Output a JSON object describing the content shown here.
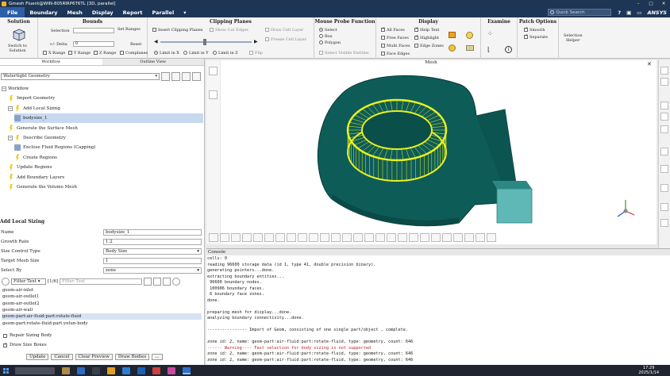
{
  "titlebar": {
    "title": "Gmesh Fluent@WIN-805RIRP6T6TL  [3D, parallel]"
  },
  "menu": {
    "items": [
      "File",
      "Boundary",
      "Mesh",
      "Display",
      "Report",
      "Parallel"
    ],
    "search_placeholder": "Quick Search",
    "brand": "ANSYS"
  },
  "ribbon": {
    "solution": {
      "title": "Solution",
      "button": "Switch to\nSolution"
    },
    "bounds": {
      "title": "Bounds",
      "selection_label": "Selection",
      "set_ranges": "Set Ranges",
      "delta_label": "+/- Delta",
      "delta_value": "0",
      "reset": "Reset",
      "x_range": "X Range",
      "y_range": "Y Range",
      "z_range": "Z Range",
      "complanes": "Complanes"
    },
    "clipping": {
      "title": "Clipping Planes",
      "insert": "Insert Clipping Planes",
      "show_cut_edges": "Show Cut Edges",
      "draw_cell_layer": "Draw Cell Layer",
      "freeze_cell_layer": "Freeze Cell Layer",
      "flip": "Flip",
      "limit_x": "Limit in X",
      "limit_y": "Limit in Y",
      "limit_z": "Limit in Z"
    },
    "probe": {
      "title": "Mouse Probe Function",
      "select": "Select",
      "box": "Box",
      "polygon": "Polygon",
      "select_visible": "Select Visible Entities"
    },
    "display": {
      "title": "Display",
      "all_faces": "All Faces",
      "free_faces": "Free Faces",
      "multi_faces": "Multi Faces",
      "face_edges": "Face Edges",
      "help_text": "Help Text",
      "highlight": "Highlight",
      "edge_zones": "Edge Zones"
    },
    "examine": {
      "title": "Examine"
    },
    "patch": {
      "title": "Patch Options",
      "smooth": "Smooth",
      "separate": "Separate"
    },
    "selection_helper": "Selection\nHelper"
  },
  "left": {
    "tabs": [
      "Workflow",
      "Outline View"
    ],
    "workflow_type": "Watertight Geometry",
    "tree": [
      {
        "label": "Workflow",
        "indent": 0,
        "kind": "root"
      },
      {
        "label": "Import Geometry",
        "indent": 1,
        "kind": "task"
      },
      {
        "label": "Add Local Sizing",
        "indent": 1,
        "kind": "task"
      },
      {
        "label": "bodysize_1",
        "indent": 2,
        "kind": "child"
      },
      {
        "label": "Generate the Surface Mesh",
        "indent": 1,
        "kind": "task"
      },
      {
        "label": "Describe Geometry",
        "indent": 1,
        "kind": "task"
      },
      {
        "label": "Enclose Fluid Regions (Capping)",
        "indent": 2,
        "kind": "child"
      },
      {
        "label": "Create Regions",
        "indent": 2,
        "kind": "task"
      },
      {
        "label": "Update Regions",
        "indent": 1,
        "kind": "task"
      },
      {
        "label": "Add Boundary Layers",
        "indent": 1,
        "kind": "task"
      },
      {
        "label": "Generate the Volume Mesh",
        "indent": 1,
        "kind": "task"
      }
    ],
    "sizing": {
      "header": "Add Local Sizing",
      "rows": [
        {
          "k": "Name",
          "v": "bodysize_1",
          "dd": false
        },
        {
          "k": "Growth Rate",
          "v": "1.2",
          "dd": false
        },
        {
          "k": "Size Control Type",
          "v": "Body Size",
          "dd": true
        },
        {
          "k": "Target Mesh Size",
          "v": "1",
          "dd": false
        },
        {
          "k": "Select By",
          "v": "zone",
          "dd": true
        }
      ],
      "filter_label": "Filter Text",
      "count": "[1/6]",
      "filter_placeholder": "Filter Text",
      "items": [
        "geom-air-inlet",
        "geom-air-outlet1",
        "geom-air-outlet2",
        "geom-air-wall",
        "geom-part:air-fluid:part:rotate-fluid",
        "geom-part:rotate-fluid:part:yelun-body"
      ],
      "selected_index": 4,
      "repair": "Repair Sizing Body",
      "draw_size_boxes": "Draw Size Boxes",
      "buttons": [
        "Update",
        "Cancel",
        "Clear Preview",
        "Draw Bodies",
        "..."
      ]
    }
  },
  "viewport": {
    "title": "Mesh"
  },
  "console": {
    "title": "Console",
    "lines": [
      "cells: 0",
      "reading 96600 storage data (id 1, type 41, double precision binary).",
      "generating pointers...done.",
      "extracting boundary entities...",
      " 96600 boundary nodes.",
      " 100906 boundary faces.",
      " 6 boundary face zones.",
      "done.",
      "",
      "preparing mesh for display...done.",
      "analyzing boundary connectivity...done.",
      "",
      "---------------- Import of Geom, consisting of one single part/object , complete.",
      "",
      "zone id: 2, name: geom-part:air-fluid:part:rotate-fluid, type: geometry, count: 646",
      "------ Warning---- Fast selection for body sizing is not supported",
      "zone id: 2, name: geom-part:air-fluid:part:rotate-fluid, type: geometry, count: 646",
      "zone id: 2, name: geom-part:air-fluid:part:rotate-fluid, type: geometry, count: 646"
    ],
    "warning_index": 15
  },
  "taskbar": {
    "time": "17:29",
    "date": "2025/1/14"
  }
}
